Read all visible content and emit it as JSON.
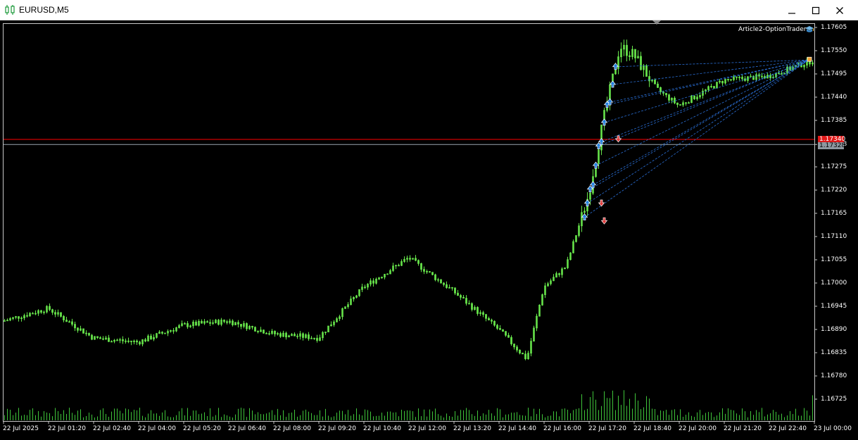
{
  "window": {
    "title": "EURUSD,M5",
    "minimize_label": "minimize",
    "maximize_label": "maximize",
    "close_label": "close"
  },
  "expert": {
    "name": "Article2-OptionTrader",
    "icon": "graduation-cap-icon"
  },
  "price_axis": {
    "ticks": [
      "1.17605",
      "1.17550",
      "1.17495",
      "1.17440",
      "1.17385",
      "1.17328",
      "1.17275",
      "1.17220",
      "1.17165",
      "1.17110",
      "1.17055",
      "1.17000",
      "1.16945",
      "1.16890",
      "1.16835",
      "1.16780",
      "1.16725"
    ],
    "ask_label": "1.17340",
    "bid_label": "1.17328"
  },
  "time_axis": {
    "ticks": [
      "22 Jul 2025",
      "22 Jul 01:20",
      "22 Jul 02:40",
      "22 Jul 04:00",
      "22 Jul 05:20",
      "22 Jul 06:40",
      "22 Jul 08:00",
      "22 Jul 09:20",
      "22 Jul 10:40",
      "22 Jul 12:00",
      "22 Jul 13:20",
      "22 Jul 14:40",
      "22 Jul 16:00",
      "22 Jul 17:20",
      "22 Jul 18:40",
      "22 Jul 20:00",
      "22 Jul 21:20",
      "22 Jul 22:40",
      "23 Jul 00:00"
    ]
  },
  "colors": {
    "candle": "#66e34a",
    "volume": "#3fc43a",
    "ask_line": "#ff0000",
    "bid_line": "#9aa4ae",
    "trade_link": "#2a6fd6",
    "buy_arrow": "#1e7fe0",
    "sell_arrow": "#e23b3b"
  },
  "chart_data": {
    "type": "candlestick",
    "symbol": "EURUSD",
    "timeframe": "M5",
    "ylim": [
      1.167,
      1.1762
    ],
    "x_range": [
      "22 Jul 2025 00:00",
      "23 Jul 00:00"
    ],
    "key_points": [
      {
        "time": "22 Jul 00:00",
        "price": 1.1691
      },
      {
        "time": "22 Jul 01:20",
        "price": 1.1694
      },
      {
        "time": "22 Jul 02:40",
        "price": 1.1687
      },
      {
        "time": "22 Jul 04:00",
        "price": 1.1686
      },
      {
        "time": "22 Jul 05:20",
        "price": 1.169
      },
      {
        "time": "22 Jul 06:40",
        "price": 1.1691
      },
      {
        "time": "22 Jul 08:00",
        "price": 1.1688
      },
      {
        "time": "22 Jul 09:20",
        "price": 1.1687
      },
      {
        "time": "22 Jul 10:40",
        "price": 1.1699
      },
      {
        "time": "22 Jul 12:00",
        "price": 1.1706
      },
      {
        "time": "22 Jul 13:20",
        "price": 1.1698
      },
      {
        "time": "22 Jul 14:40",
        "price": 1.1689
      },
      {
        "time": "22 Jul 15:30",
        "price": 1.1682
      },
      {
        "time": "22 Jul 16:00",
        "price": 1.1699
      },
      {
        "time": "22 Jul 16:40",
        "price": 1.1704
      },
      {
        "time": "22 Jul 17:20",
        "price": 1.1721
      },
      {
        "time": "22 Jul 17:45",
        "price": 1.1738
      },
      {
        "time": "22 Jul 18:15",
        "price": 1.1756
      },
      {
        "time": "22 Jul 18:40",
        "price": 1.1754
      },
      {
        "time": "22 Jul 19:20",
        "price": 1.1746
      },
      {
        "time": "22 Jul 20:00",
        "price": 1.1742
      },
      {
        "time": "22 Jul 21:20",
        "price": 1.1748
      },
      {
        "time": "22 Jul 22:40",
        "price": 1.1749
      },
      {
        "time": "23 Jul 00:00",
        "price": 1.17528
      }
    ],
    "ask_price": 1.1734,
    "bid_price": 1.17328
  }
}
